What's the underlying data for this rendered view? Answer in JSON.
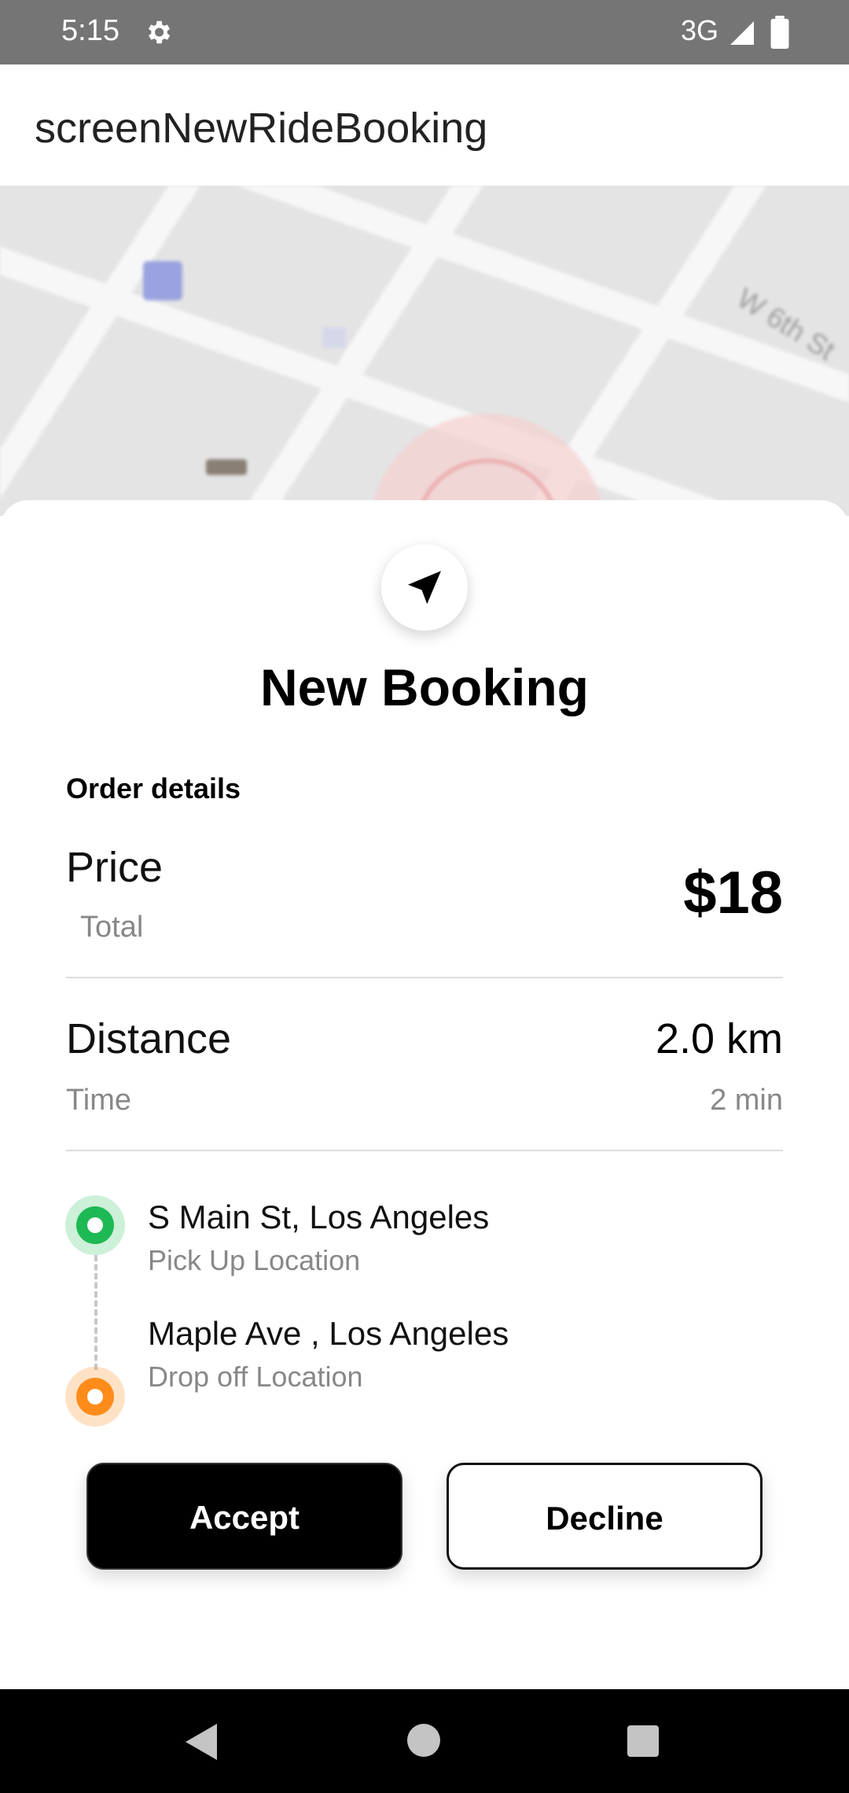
{
  "status_bar": {
    "time": "5:15",
    "network": "3G",
    "icons": [
      "settings-icon",
      "signal-icon",
      "battery-icon"
    ]
  },
  "app_bar": {
    "title": "screenNewRideBooking"
  },
  "map": {
    "street_label": "W 6th St",
    "icons": [
      "transit-icon",
      "location-radius"
    ]
  },
  "booking": {
    "icon": "navigation-arrow-icon",
    "title": "New Booking",
    "order_heading": "Order details",
    "price": {
      "label": "Price",
      "sublabel": "Total",
      "value": "$18"
    },
    "distance": {
      "label": "Distance",
      "value": "2.0 km"
    },
    "time": {
      "label": "Time",
      "value": "2 min"
    },
    "pickup": {
      "name": "S Main St, Los Angeles",
      "label": "Pick Up Location",
      "color": "#1db954"
    },
    "dropoff": {
      "name": "Maple Ave , Los Angeles",
      "label": "Drop off Location",
      "color": "#ff8c1a"
    },
    "actions": {
      "accept": "Accept",
      "decline": "Decline"
    }
  },
  "system_nav": {
    "icons": [
      "back-icon",
      "home-icon",
      "recents-icon"
    ]
  },
  "colors": {
    "status_bar": "#757575",
    "primary": "#000000",
    "muted_text": "#888888"
  }
}
